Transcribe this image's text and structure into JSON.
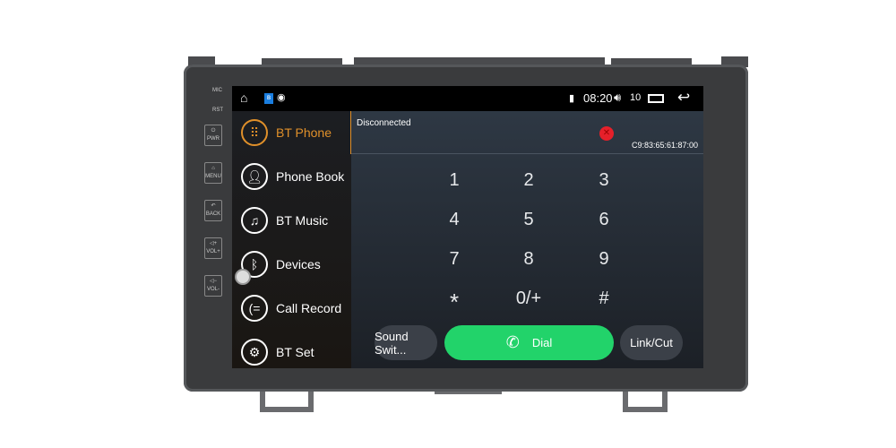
{
  "device": {
    "labels": {
      "mic": "MIC",
      "rst": "RST",
      "pwr": "PWR",
      "menu": "MENU",
      "back": "BACK",
      "vol_up": "VOL+",
      "vol_down": "VOL-"
    }
  },
  "status_bar": {
    "time": "08:20",
    "volume": "10",
    "icons": [
      "home-icon",
      "bluetooth-badge-icon",
      "wireless-icon",
      "sim-icon",
      "volume-icon",
      "recent-apps-icon",
      "back-icon"
    ]
  },
  "sidebar": {
    "items": [
      {
        "label": "BT Phone",
        "icon": "dialpad-icon",
        "active": true
      },
      {
        "label": "Phone Book",
        "icon": "contact-icon"
      },
      {
        "label": "BT Music",
        "icon": "music-icon"
      },
      {
        "label": "Devices",
        "icon": "bluetooth-icon"
      },
      {
        "label": "Call Record",
        "icon": "call-log-icon"
      },
      {
        "label": "BT Set",
        "icon": "gear-icon"
      }
    ]
  },
  "phone": {
    "status": "Disconnected",
    "mac": "C9:83:65:61:87:00",
    "keys": [
      "1",
      "2",
      "3",
      "4",
      "5",
      "6",
      "7",
      "8",
      "9",
      "*",
      "0/+",
      "#"
    ],
    "sound_switch": "Sound Swit...",
    "dial": "Dial",
    "link_cut": "Link/Cut"
  },
  "colors": {
    "accent": "#e0902a",
    "dial": "#22d36a",
    "error": "#e5202a"
  }
}
